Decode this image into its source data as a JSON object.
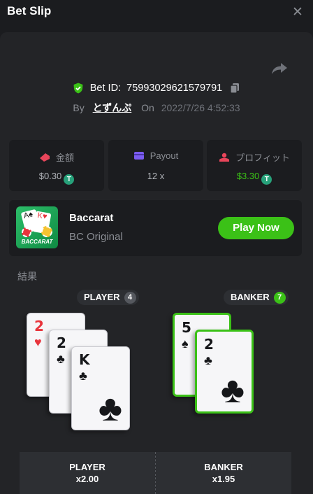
{
  "header": {
    "title": "Bet Slip",
    "close_icon": "close-icon"
  },
  "bet": {
    "id_label": "Bet ID:",
    "id": "75993029621579791",
    "by_label": "By",
    "user": "とずんぷ",
    "on_label": "On",
    "date": "2022/7/26 4:52:33"
  },
  "stats": [
    {
      "label": "金額",
      "value": "$0.30",
      "icon": "bet-amount-icon",
      "color": "#e8455a"
    },
    {
      "label": "Payout",
      "value": "12 x",
      "icon": "wallet-icon",
      "color": "#7b5cf0"
    },
    {
      "label": "プロフィット",
      "value": "$3.30",
      "icon": "profit-icon",
      "color": "#e8455a"
    }
  ],
  "game": {
    "name": "Baccarat",
    "provider": "BC Original",
    "play_label": "Play Now",
    "thumb_text": "BACCARAT"
  },
  "result_label": "結果",
  "player": {
    "label": "PLAYER",
    "count": "4",
    "cards": [
      {
        "rank": "2",
        "suit": "♥"
      },
      {
        "rank": "2",
        "suit": "♣"
      },
      {
        "rank": "K",
        "suit": "♣"
      }
    ]
  },
  "banker": {
    "label": "BANKER",
    "count": "7",
    "cards": [
      {
        "rank": "5",
        "suit": "♠"
      },
      {
        "rank": "2",
        "suit": "♣"
      }
    ]
  },
  "bottom": [
    {
      "label": "PLAYER",
      "odds": "x2.00"
    },
    {
      "label": "BANKER",
      "odds": "x1.95"
    }
  ],
  "colors": {
    "accent": "#3bc117",
    "panel": "#232427",
    "card": "#1b1c1f"
  },
  "token": "T"
}
